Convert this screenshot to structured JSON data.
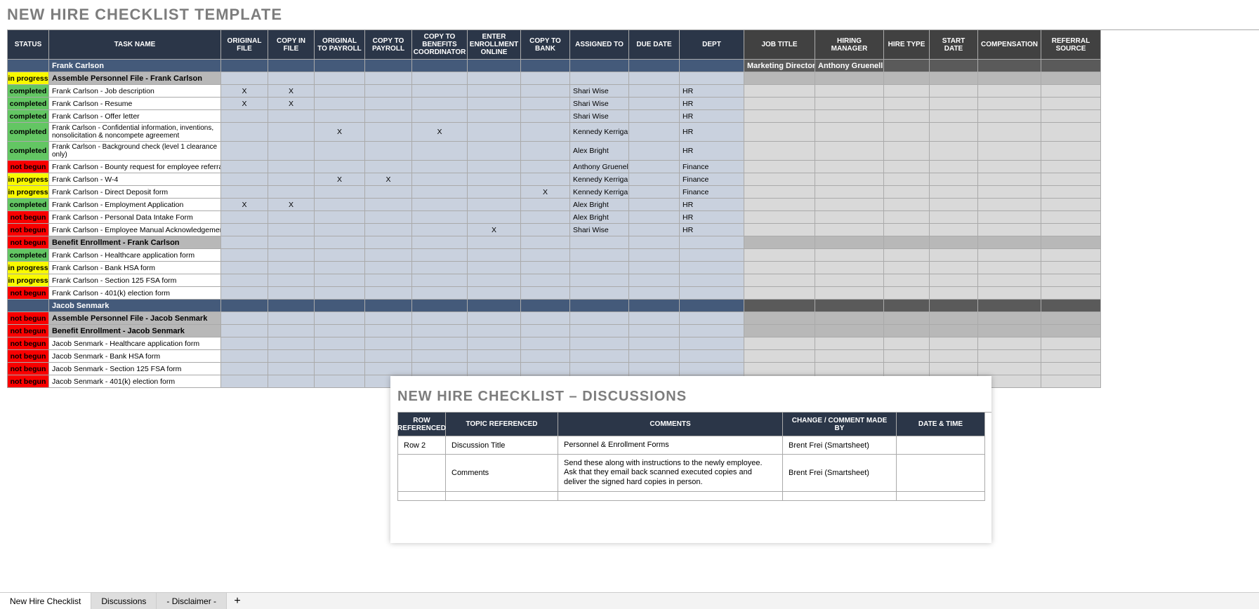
{
  "title": "NEW HIRE CHECKLIST TEMPLATE",
  "columns_main": [
    "STATUS",
    "TASK NAME",
    "ORIGINAL FILE",
    "COPY IN FILE",
    "ORIGINAL TO PAYROLL",
    "COPY TO PAYROLL",
    "COPY TO BENEFITS COORDINATOR",
    "ENTER ENROLLMENT ONLINE",
    "COPY TO BANK",
    "ASSIGNED TO",
    "DUE DATE",
    "DEPT"
  ],
  "columns_right": [
    "JOB TITLE",
    "HIRING MANAGER",
    "HIRE TYPE",
    "START DATE",
    "COMPENSATION",
    "REFERRAL SOURCE"
  ],
  "rows": [
    {
      "type": "name",
      "status": "",
      "task": "Frank Carlson",
      "job_title": "Marketing Director",
      "hiring_manager": "Anthony Gruenelli"
    },
    {
      "type": "section",
      "status": "in progress",
      "task": "Assemble Personnel File - Frank Carlson"
    },
    {
      "type": "body",
      "status": "completed",
      "task": "Frank Carlson - Job description",
      "checks": {
        "c0": "X",
        "c1": "X"
      },
      "assigned": "Shari Wise",
      "dept": "HR"
    },
    {
      "type": "body",
      "status": "completed",
      "task": "Frank Carlson - Resume",
      "checks": {
        "c0": "X",
        "c1": "X"
      },
      "assigned": "Shari Wise",
      "dept": "HR"
    },
    {
      "type": "body",
      "status": "completed",
      "task": "Frank Carlson - Offer letter",
      "checks": {},
      "assigned": "Shari Wise",
      "dept": "HR"
    },
    {
      "type": "body",
      "tall": true,
      "status": "completed",
      "task": "Frank Carlson - Confidential information, inventions, nonsolicitation & noncompete agreement",
      "checks": {
        "c2": "X",
        "c4": "X"
      },
      "assigned": "Kennedy Kerrigan",
      "dept": "HR"
    },
    {
      "type": "body",
      "tall": true,
      "status": "completed",
      "task": "Frank Carlson - Background check (level 1 clearance only)",
      "checks": {},
      "assigned": "Alex Bright",
      "dept": "HR"
    },
    {
      "type": "body",
      "status": "not begun",
      "task": "Frank Carlson - Bounty request for employee referral",
      "checks": {},
      "assigned": "Anthony Gruenelli",
      "dept": "Finance"
    },
    {
      "type": "body",
      "status": "in progress",
      "task": "Frank Carlson - W-4",
      "checks": {
        "c2": "X",
        "c3": "X"
      },
      "assigned": "Kennedy Kerrigan",
      "dept": "Finance"
    },
    {
      "type": "body",
      "status": "in progress",
      "task": "Frank Carlson - Direct Deposit form",
      "checks": {
        "c6": "X"
      },
      "assigned": "Kennedy Kerrigan",
      "dept": "Finance"
    },
    {
      "type": "body",
      "status": "completed",
      "task": "Frank Carlson - Employment Application",
      "checks": {
        "c0": "X",
        "c1": "X"
      },
      "assigned": "Alex Bright",
      "dept": "HR"
    },
    {
      "type": "body",
      "status": "not begun",
      "task": "Frank Carlson - Personal Data Intake Form",
      "checks": {},
      "assigned": "Alex Bright",
      "dept": "HR"
    },
    {
      "type": "body",
      "status": "not begun",
      "task": "Frank Carlson - Employee Manual Acknowledgement",
      "checks": {
        "c5": "X"
      },
      "assigned": "Shari Wise",
      "dept": "HR"
    },
    {
      "type": "section",
      "status": "not begun",
      "task": "Benefit Enrollment - Frank Carlson"
    },
    {
      "type": "body",
      "status": "completed",
      "task": "Frank Carlson - Healthcare application form",
      "checks": {}
    },
    {
      "type": "body",
      "status": "in progress",
      "task": "Frank Carlson - Bank HSA form",
      "checks": {}
    },
    {
      "type": "body",
      "status": "in progress",
      "task": "Frank Carlson - Section 125 FSA form",
      "checks": {}
    },
    {
      "type": "body",
      "status": "not begun",
      "task": "Frank Carlson - 401(k) election form",
      "checks": {}
    },
    {
      "type": "name",
      "status": "",
      "task": "Jacob Senmark"
    },
    {
      "type": "section",
      "status": "not begun",
      "task": "Assemble Personnel File - Jacob Senmark"
    },
    {
      "type": "section",
      "status": "not begun",
      "task": "Benefit Enrollment - Jacob Senmark"
    },
    {
      "type": "body",
      "status": "not begun",
      "task": "Jacob Senmark - Healthcare application form",
      "checks": {}
    },
    {
      "type": "body",
      "status": "not begun",
      "task": "Jacob Senmark - Bank HSA form",
      "checks": {}
    },
    {
      "type": "body",
      "status": "not begun",
      "task": "Jacob Senmark - Section 125 FSA form",
      "checks": {}
    },
    {
      "type": "body",
      "status": "not begun",
      "task": "Jacob Senmark - 401(k) election form",
      "checks": {}
    }
  ],
  "discussions": {
    "title": "NEW HIRE CHECKLIST  –  DISCUSSIONS",
    "columns": [
      "ROW REFERENCED",
      "TOPIC REFERENCED",
      "COMMENTS",
      "CHANGE / COMMENT MADE BY",
      "DATE & TIME"
    ],
    "rows": [
      {
        "row_ref": "Row 2",
        "topic": "Discussion Title",
        "comments": "Personnel & Enrollment Forms",
        "by": "Brent Frei (Smartsheet)",
        "dt": ""
      },
      {
        "row_ref": "",
        "topic": "Comments",
        "comments": "Send these along with instructions to the newly employee.  Ask that they email back scanned executed copies and deliver the signed hard copies in person.",
        "by": "Brent Frei (Smartsheet)",
        "dt": ""
      },
      {
        "row_ref": "",
        "topic": "",
        "comments": "",
        "by": "",
        "dt": ""
      }
    ]
  },
  "tabs": {
    "items": [
      "New Hire Checklist",
      "Discussions",
      "- Disclaimer -"
    ],
    "add": "+"
  }
}
